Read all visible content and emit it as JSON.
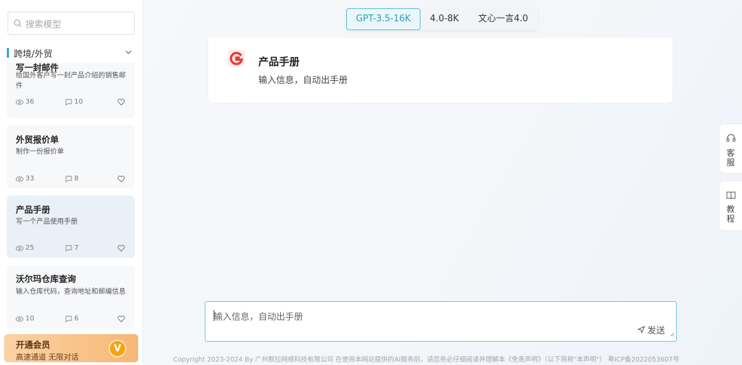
{
  "sidebar": {
    "search": {
      "placeholder": "搜索模型"
    },
    "category": {
      "label": "跨境/外贸"
    },
    "cards": [
      {
        "title": "写一封邮件",
        "desc": "给国外客户写一封产品介绍的销售邮件",
        "views": "36",
        "comments": "10"
      },
      {
        "title": "外贸报价单",
        "desc": "制作一份报价单",
        "views": "33",
        "comments": "8"
      },
      {
        "title": "产品手册",
        "desc": "写一个产品使用手册",
        "views": "25",
        "comments": "7",
        "active": true
      },
      {
        "title": "沃尔玛仓库查询",
        "desc": "输入仓库代码，查询地址和邮编信息",
        "views": "10",
        "comments": "6"
      }
    ],
    "vip": {
      "title": "开通会员",
      "subtitle": "高速通道 无限对话",
      "badge": "V"
    }
  },
  "model_tabs": [
    {
      "label": "GPT-3.5-16K",
      "active": true
    },
    {
      "label": "4.0-8K",
      "active": false
    },
    {
      "label": "文心一言4.0",
      "active": false
    }
  ],
  "info_card": {
    "title": "产品手册",
    "desc": "输入信息，自动出手册"
  },
  "floaters": {
    "service": "客服",
    "tutorial": "教程"
  },
  "composer": {
    "placeholder": "输入信息，自动出手册",
    "send_label": "发送"
  },
  "footer": {
    "text": "Copyright 2023-2024 By 广州默拉网络科技有限公司 在使用本网站提供的AI服务前，请您务必仔细阅读并理解本《免责声明》（以下简称\"本声明\"）    粤ICP备2022053607号"
  },
  "colors": {
    "accent": "#2aa0b8",
    "category_bar": "#35a3c8",
    "vip_bg": "#f7b774",
    "active_card": "#eaf0f8"
  }
}
